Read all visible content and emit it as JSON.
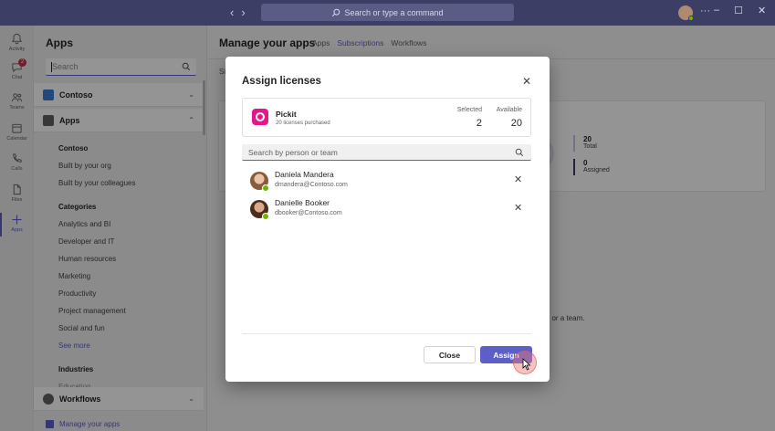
{
  "titlebar": {
    "search_placeholder": "Search or type a command",
    "back_glyph": "‹",
    "forward_glyph": "›",
    "more_glyph": "···",
    "minimize_glyph": "–",
    "maximize_glyph": "☐",
    "close_glyph": "✕"
  },
  "rail": {
    "items": [
      {
        "label": "Activity",
        "icon": "bell-icon"
      },
      {
        "label": "Chat",
        "icon": "chat-icon",
        "badge": "2"
      },
      {
        "label": "Teams",
        "icon": "teams-icon"
      },
      {
        "label": "Calendar",
        "icon": "calendar-icon"
      },
      {
        "label": "Calls",
        "icon": "phone-icon"
      },
      {
        "label": "Files",
        "icon": "file-icon"
      },
      {
        "label": "Apps",
        "icon": "plus-icon",
        "active": true
      }
    ]
  },
  "left_panel": {
    "title": "Apps",
    "search_placeholder": "Search",
    "section_contoso": "Contoso",
    "section_apps": "Apps",
    "contoso_heading": "Contoso",
    "contoso_items": [
      "Built by your org",
      "Built by your colleagues"
    ],
    "categories_heading": "Categories",
    "categories": [
      "Analytics and BI",
      "Developer and IT",
      "Human resources",
      "Marketing",
      "Productivity",
      "Project management",
      "Social and fun"
    ],
    "see_more": "See more",
    "industries_heading": "Industries",
    "industries_partial": "Education",
    "section_workflows": "Workflows",
    "manage_apps": "Manage your apps"
  },
  "main": {
    "title": "Manage your apps",
    "tabs": [
      "Apps",
      "Subscriptions",
      "Workflows"
    ],
    "selected_tab": "Subscriptions",
    "sub_partial": "Su",
    "stat_total_value": "20",
    "stat_total_label": "Total",
    "stat_assigned_value": "0",
    "stat_assigned_label": "Assigned",
    "bg_text": "le or a team."
  },
  "modal": {
    "title": "Assign licenses",
    "close_glyph": "✕",
    "app": {
      "name": "Pickit",
      "subtitle": "20 licenses purchased",
      "selected_label": "Selected",
      "selected_value": "2",
      "available_label": "Available",
      "available_value": "20"
    },
    "search_placeholder": "Search by person or team",
    "people": [
      {
        "name": "Daniela Mandera",
        "email": "dmandera@Contoso.com",
        "remove_glyph": "✕"
      },
      {
        "name": "Danielle Booker",
        "email": "dbooker@Contoso.com",
        "remove_glyph": "✕"
      }
    ],
    "close_button": "Close",
    "assign_button": "Assign"
  },
  "colors": {
    "accent": "#5b5fc7",
    "titlebar": "#3d3e66",
    "pickit": "#e3178b",
    "presence_available": "#6bb700"
  }
}
